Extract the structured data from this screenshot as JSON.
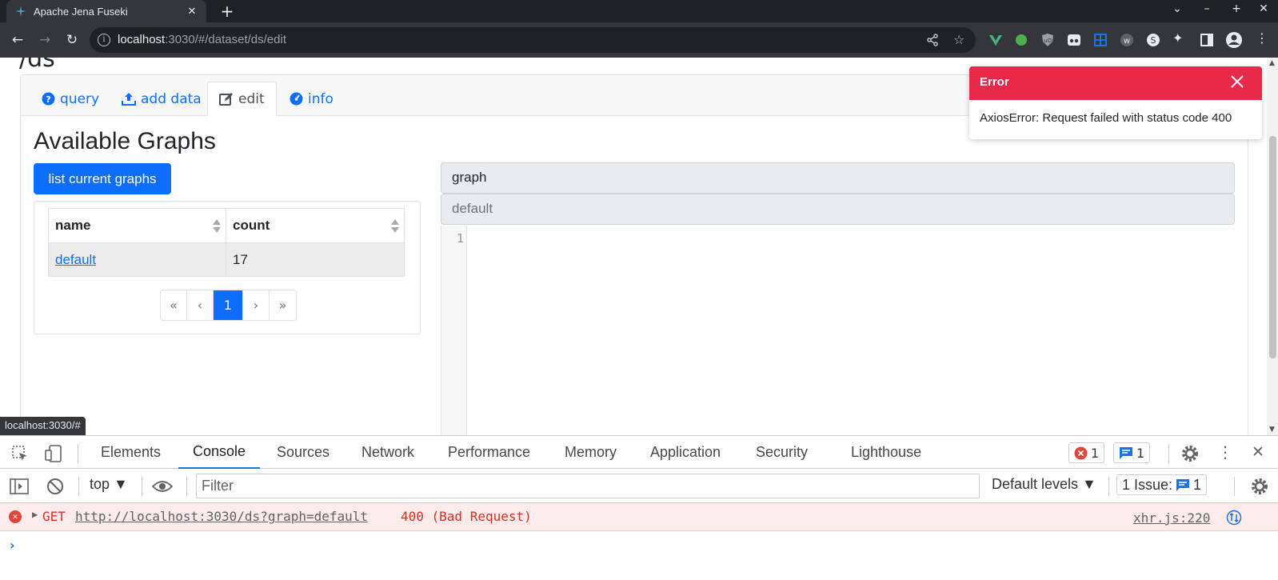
{
  "browser": {
    "tab_title": "Apache Jena Fuseki",
    "tab_close": "✕",
    "new_tab": "+",
    "url_host": "localhost",
    "url_rest": ":3030/#/dataset/ds/edit",
    "status_url": "localhost:3030/#"
  },
  "page": {
    "dataset_title": "/ds",
    "tabs": [
      {
        "label": "query"
      },
      {
        "label": "add data"
      },
      {
        "label": "edit"
      },
      {
        "label": "info"
      }
    ],
    "heading": "Available Graphs",
    "list_button": "list current graphs",
    "table": {
      "headers": [
        "name",
        "count"
      ],
      "rows": [
        [
          "default",
          "17"
        ]
      ]
    },
    "pager": [
      "«",
      "‹",
      "1",
      "›",
      "»"
    ],
    "graph_label": "graph",
    "graph_value": "default",
    "line_number": "1"
  },
  "toast": {
    "title": "Error",
    "message": "AxiosError: Request failed with status code 400"
  },
  "devtools": {
    "tabs": [
      "Elements",
      "Console",
      "Sources",
      "Network",
      "Performance",
      "Memory",
      "Application",
      "Security",
      "Lighthouse"
    ],
    "error_count": "1",
    "message_count": "1",
    "context": "top",
    "filter_placeholder": "Filter",
    "levels": "Default levels ▼",
    "issues_label": "1 Issue:",
    "issues_count": "1",
    "console": {
      "method": "GET",
      "url": "http://localhost:3030/ds?graph=default",
      "status": "400 (Bad Request)",
      "source": "xhr.js:220"
    }
  },
  "colors": {
    "primary": "#0d6efd",
    "toast_red": "#e9294a",
    "devtools_accent": "#1a73e8"
  }
}
